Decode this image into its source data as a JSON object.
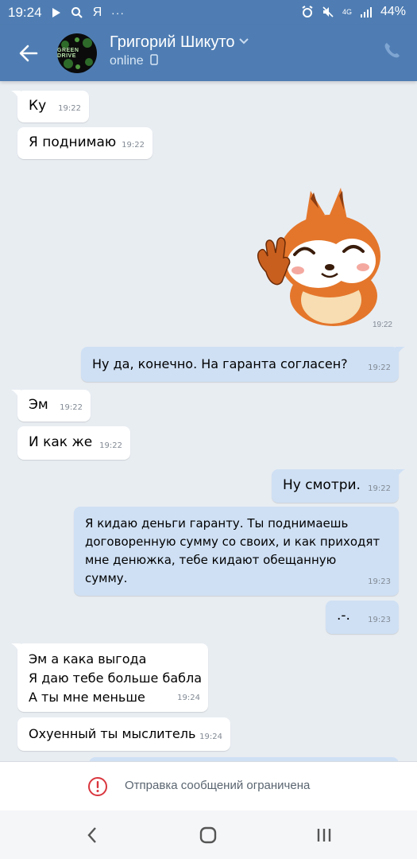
{
  "status_bar": {
    "time": "19:24",
    "battery": "44%",
    "network": "4G"
  },
  "header": {
    "name": "Григорий Шикуто",
    "status": "online",
    "avatar_text": "GREEN DRIVE"
  },
  "messages": [
    {
      "dir": "in",
      "text": "Ку",
      "time": "19:22"
    },
    {
      "dir": "in",
      "text": "Я поднимаю",
      "time": "19:22"
    },
    {
      "dir": "in",
      "type": "sticker",
      "time": "19:22"
    },
    {
      "dir": "out",
      "text": "Ну да, конечно. На гаранта согласен?",
      "time": "19:22"
    },
    {
      "dir": "in",
      "text": "Эм",
      "time": "19:22"
    },
    {
      "dir": "in",
      "text": "И как же",
      "time": "19:22"
    },
    {
      "dir": "out",
      "text": "Ну смотри.",
      "time": "19:22"
    },
    {
      "dir": "out",
      "lines": [
        "Я кидаю деньги гаранту. Ты поднимаешь",
        "договоренную сумму со своих, и как приходят",
        "мне денюжка, тебе кидают обещанную",
        "сумму."
      ],
      "time": "19:23"
    },
    {
      "dir": "out",
      "text": ".-.",
      "time": "19:23"
    },
    {
      "dir": "in",
      "lines": [
        "Эм а кака выгода",
        "Я даю тебе больше бабла",
        "А ты мне меньше"
      ],
      "time": "19:24"
    },
    {
      "dir": "in",
      "text": "Охуенный ты мыслитель",
      "time": "19:24"
    }
  ],
  "restriction": {
    "label": "Отправка сообщений ограничена"
  },
  "colors": {
    "header": "#4f7db3",
    "outgoing": "#cfe0f4",
    "incoming": "#ffffff",
    "background": "#e8edf2",
    "warning": "#d9363e"
  }
}
